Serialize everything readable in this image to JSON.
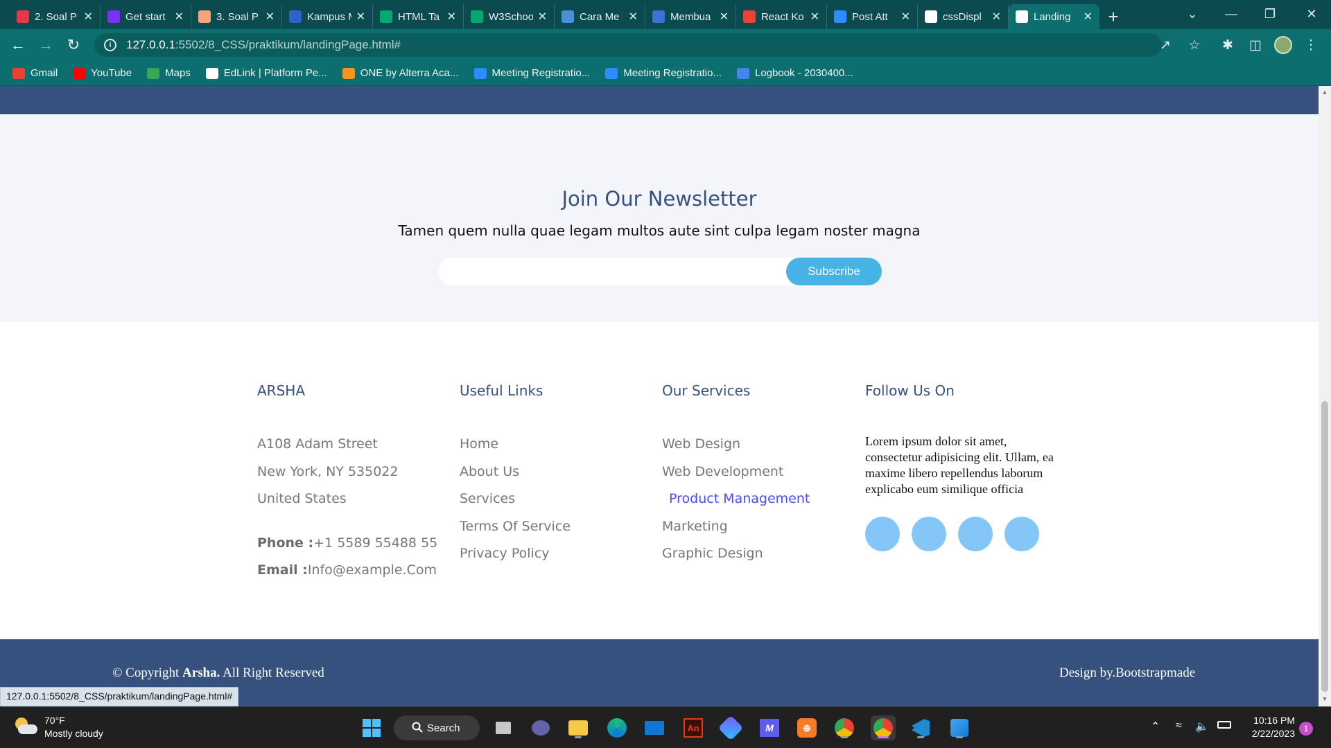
{
  "browser": {
    "tabs": [
      {
        "title": "2. Soal P",
        "icon": "book-icon",
        "color": "#e53947",
        "active": false
      },
      {
        "title": "Get start",
        "icon": "bootstrap-icon",
        "color": "#7b2ff7",
        "active": false
      },
      {
        "title": "3. Soal P",
        "icon": "book-icon",
        "color": "#f6a27a",
        "active": false
      },
      {
        "title": "Kampus M",
        "icon": "kampus-icon",
        "color": "#2d63c8",
        "active": false
      },
      {
        "title": "HTML Ta",
        "icon": "w3schools-icon",
        "color": "#04aa6d",
        "active": false
      },
      {
        "title": "W3Schoo",
        "icon": "w3schools-icon",
        "color": "#04aa6d",
        "active": false
      },
      {
        "title": "Cara Me",
        "icon": "arrow-icon",
        "color": "#4a90d9",
        "active": false
      },
      {
        "title": "Membua",
        "icon": "globe-icon",
        "color": "#3d73d6",
        "active": false
      },
      {
        "title": "React Ko",
        "icon": "gmail-icon",
        "color": "#ea4335",
        "active": false
      },
      {
        "title": "Post Att",
        "icon": "zoom-icon",
        "color": "#2d8cff",
        "active": false
      },
      {
        "title": "cssDispl",
        "icon": "globe-icon",
        "color": "#ffffff",
        "active": false
      },
      {
        "title": "Landing",
        "icon": "globe-icon",
        "color": "#ffffff",
        "active": true
      }
    ],
    "address": {
      "host": "127.0.0.1",
      "path": ":5502/8_CSS/praktikum/landingPage.html#"
    },
    "bookmarks": [
      {
        "label": "Gmail",
        "icon": "gmail-icon",
        "color": "#ea4335"
      },
      {
        "label": "YouTube",
        "icon": "youtube-icon",
        "color": "#ff0000"
      },
      {
        "label": "Maps",
        "icon": "maps-icon",
        "color": "#34a853"
      },
      {
        "label": "EdLink | Platform Pe...",
        "icon": "globe-icon",
        "color": "#ffffff"
      },
      {
        "label": "ONE by Alterra Aca...",
        "icon": "alterra-icon",
        "color": "#f7941d"
      },
      {
        "label": "Meeting Registratio...",
        "icon": "zoom-icon",
        "color": "#2d8cff"
      },
      {
        "label": "Meeting Registratio...",
        "icon": "zoom-icon",
        "color": "#2d8cff"
      },
      {
        "label": "Logbook - 2030400...",
        "icon": "docs-icon",
        "color": "#4285f4"
      }
    ],
    "status_url": "127.0.0.1:5502/8_CSS/praktikum/landingPage.html#"
  },
  "newsletter": {
    "title": "Join Our Newsletter",
    "subtitle": "Tamen quem nulla quae legam multos aute sint culpa legam noster magna",
    "email_placeholder": "",
    "button": "Subscribe"
  },
  "footer": {
    "brand": {
      "title": "ARSHA",
      "address": [
        "A108 Adam Street",
        "New York, NY 535022",
        "United States"
      ],
      "phone_label": "Phone :",
      "phone": "+1 5589 55488 55",
      "email_label": "Email :",
      "email": "Info@example.Com"
    },
    "useful_links": {
      "title": "Useful Links",
      "items": [
        "Home",
        "About Us",
        "Services",
        "Terms Of Service",
        "Privacy Policy"
      ]
    },
    "services": {
      "title": "Our Services",
      "items": [
        "Web Design",
        "Web Development",
        "Product Management",
        "Marketing",
        "Graphic Design"
      ],
      "highlighted": "Product Management"
    },
    "follow": {
      "title": "Follow Us On",
      "text": "Lorem ipsum dolor sit amet, consectetur adipisicing elit. Ullam, ea maxime libero repellendus laborum explicabo eum similique officia",
      "socials": 4
    },
    "copyright_prefix": "© Copyright ",
    "copyright_brand": "Arsha.",
    "copyright_suffix": " All Right Reserved",
    "credit": "Design by.Bootstrapmade"
  },
  "colors": {
    "primary": "#37517e",
    "accent": "#47b2e4",
    "social": "#84c6f8",
    "annotation": "#e0151b",
    "highlight": "#4b4bff"
  },
  "taskbar": {
    "weather_temp": "70°F",
    "weather_desc": "Mostly cloudy",
    "search_label": "Search",
    "time": "10:16 PM",
    "date": "2/22/2023",
    "notifications": "1",
    "apps": [
      "start-icon",
      "task-view-icon",
      "teams-icon",
      "file-explorer-icon",
      "edge-icon",
      "mail-icon",
      "animate-icon",
      "copilot-icon",
      "visual-studio-icon",
      "xampp-icon",
      "chrome-icon",
      "chrome-icon",
      "vscode-icon",
      "paint-icon"
    ]
  }
}
